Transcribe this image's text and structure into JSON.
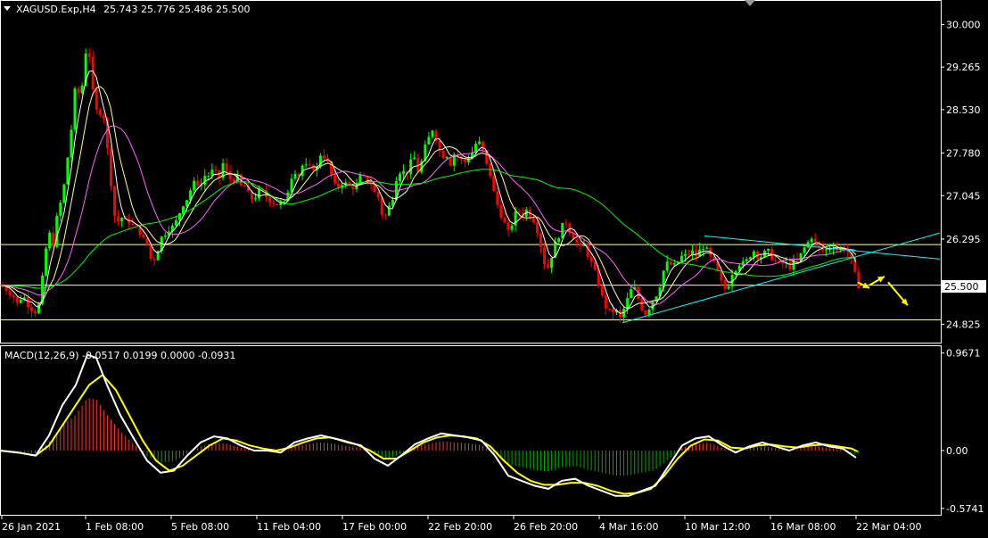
{
  "header": {
    "symbol": "XAGUSD.Exp,H4",
    "ohlc": "25.743 25.776 25.486 25.500",
    "menu_icon": "triangle-down-icon"
  },
  "macd_header": {
    "label": "MACD(12,26,9) -0.0517 0.0199 0.0000 -0.0931"
  },
  "colors": {
    "background": "#000000",
    "frame": "#ffffff",
    "bull_candle": "#00ff00",
    "bear_candle": "#ff0000",
    "ma_fast": "#ffff99",
    "ma_mid": "#ff66ff",
    "ma_slow": "#00ff00",
    "ma_white": "#ffffff",
    "trendline": "#00ffff",
    "hline": "#ffff99",
    "arrow": "#ffff00",
    "macd_line": "#ffffff",
    "signal_line": "#ffff00",
    "hist_pos": "#ff3333",
    "hist_neg": "#00aa00"
  },
  "chart_data": [
    {
      "type": "candlestick",
      "title": "XAGUSD.Exp,H4",
      "y_ticks": [
        "30.000",
        "29.265",
        "28.530",
        "27.780",
        "27.045",
        "26.295",
        "25.500",
        "24.825"
      ],
      "ylim": [
        24.6,
        30.3
      ],
      "x_ticks": [
        "26 Jan 2021",
        "1 Feb 08:00",
        "5 Feb 08:00",
        "11 Feb 04:00",
        "17 Feb 00:00",
        "22 Feb 20:00",
        "26 Feb 20:00",
        "4 Mar 16:00",
        "10 Mar 12:00",
        "16 Mar 08:00",
        "22 Mar 04:00"
      ],
      "current_price": "25.500",
      "horizontal_levels": [
        26.2,
        25.5,
        24.9
      ],
      "close_path": [
        [
          0,
          25.5
        ],
        [
          5,
          25.45
        ],
        [
          10,
          25.4
        ],
        [
          15,
          25.3
        ],
        [
          20,
          25.15
        ],
        [
          25,
          25.35
        ],
        [
          30,
          25.2
        ],
        [
          35,
          25.1
        ],
        [
          40,
          25.05
        ],
        [
          45,
          25.2
        ],
        [
          50,
          26.0
        ],
        [
          55,
          26.4
        ],
        [
          60,
          26.2
        ],
        [
          65,
          26.8
        ],
        [
          70,
          27.0
        ],
        [
          75,
          27.6
        ],
        [
          80,
          28.2
        ],
        [
          85,
          29.0
        ],
        [
          90,
          28.7
        ],
        [
          95,
          29.3
        ],
        [
          98,
          29.9
        ],
        [
          100,
          29.5
        ],
        [
          105,
          28.7
        ],
        [
          110,
          28.4
        ],
        [
          115,
          28.6
        ],
        [
          120,
          27.9
        ],
        [
          125,
          27.2
        ],
        [
          130,
          26.5
        ],
        [
          135,
          26.7
        ],
        [
          140,
          26.6
        ],
        [
          145,
          26.6
        ],
        [
          150,
          26.5
        ],
        [
          155,
          26.5
        ],
        [
          160,
          26.3
        ],
        [
          165,
          26.2
        ],
        [
          170,
          25.9
        ],
        [
          175,
          26.0
        ],
        [
          180,
          26.3
        ],
        [
          185,
          26.4
        ],
        [
          190,
          26.5
        ],
        [
          195,
          26.5
        ],
        [
          200,
          26.7
        ],
        [
          205,
          26.9
        ],
        [
          210,
          27.0
        ],
        [
          215,
          27.2
        ],
        [
          220,
          27.3
        ],
        [
          225,
          27.2
        ],
        [
          230,
          27.4
        ],
        [
          235,
          27.4
        ],
        [
          240,
          27.5
        ],
        [
          245,
          27.3
        ],
        [
          250,
          27.6
        ],
        [
          255,
          27.4
        ],
        [
          260,
          27.3
        ],
        [
          265,
          27.4
        ],
        [
          270,
          27.2
        ],
        [
          275,
          27.2
        ],
        [
          280,
          27.0
        ],
        [
          285,
          27.0
        ],
        [
          290,
          27.1
        ],
        [
          295,
          27.1
        ],
        [
          300,
          27.0
        ],
        [
          305,
          26.95
        ],
        [
          310,
          26.9
        ],
        [
          315,
          26.9
        ],
        [
          320,
          26.9
        ],
        [
          325,
          27.3
        ],
        [
          330,
          27.5
        ],
        [
          335,
          27.4
        ],
        [
          340,
          27.6
        ],
        [
          345,
          27.5
        ],
        [
          350,
          27.55
        ],
        [
          355,
          27.5
        ],
        [
          360,
          27.8
        ],
        [
          365,
          27.7
        ],
        [
          370,
          27.5
        ],
        [
          375,
          27.2
        ],
        [
          380,
          27.2
        ],
        [
          385,
          27.3
        ],
        [
          390,
          27.2
        ],
        [
          395,
          27.2
        ],
        [
          400,
          27.2
        ],
        [
          405,
          27.4
        ],
        [
          410,
          27.3
        ],
        [
          415,
          27.3
        ],
        [
          420,
          27.1
        ],
        [
          425,
          27.0
        ],
        [
          430,
          26.6
        ],
        [
          435,
          26.8
        ],
        [
          440,
          27.0
        ],
        [
          445,
          27.4
        ],
        [
          450,
          27.5
        ],
        [
          455,
          27.4
        ],
        [
          460,
          27.6
        ],
        [
          465,
          27.7
        ],
        [
          470,
          27.4
        ],
        [
          475,
          27.8
        ],
        [
          480,
          28.0
        ],
        [
          485,
          28.2
        ],
        [
          490,
          28.0
        ],
        [
          495,
          27.7
        ],
        [
          500,
          27.8
        ],
        [
          505,
          27.6
        ],
        [
          510,
          27.8
        ],
        [
          515,
          27.7
        ],
        [
          520,
          27.6
        ],
        [
          525,
          27.7
        ],
        [
          530,
          27.8
        ],
        [
          535,
          28.0
        ],
        [
          540,
          27.9
        ],
        [
          545,
          27.6
        ],
        [
          550,
          27.4
        ],
        [
          555,
          27.0
        ],
        [
          560,
          26.8
        ],
        [
          565,
          26.6
        ],
        [
          570,
          26.4
        ],
        [
          575,
          26.6
        ],
        [
          580,
          26.8
        ],
        [
          585,
          26.7
        ],
        [
          590,
          26.8
        ],
        [
          595,
          26.7
        ],
        [
          600,
          26.6
        ],
        [
          605,
          26.3
        ],
        [
          610,
          25.9
        ],
        [
          615,
          25.8
        ],
        [
          620,
          26.1
        ],
        [
          625,
          26.3
        ],
        [
          630,
          26.5
        ],
        [
          635,
          26.6
        ],
        [
          640,
          26.4
        ],
        [
          645,
          26.3
        ],
        [
          650,
          26.1
        ],
        [
          655,
          26.2
        ],
        [
          660,
          26.0
        ],
        [
          665,
          25.8
        ],
        [
          670,
          25.6
        ],
        [
          675,
          25.3
        ],
        [
          680,
          25.1
        ],
        [
          685,
          25.0
        ],
        [
          690,
          25.1
        ],
        [
          695,
          24.9
        ],
        [
          700,
          25.1
        ],
        [
          705,
          25.3
        ],
        [
          710,
          25.5
        ],
        [
          715,
          25.3
        ],
        [
          720,
          25.1
        ],
        [
          725,
          25.0
        ],
        [
          730,
          25.2
        ],
        [
          735,
          25.3
        ],
        [
          740,
          25.5
        ],
        [
          745,
          25.8
        ],
        [
          750,
          25.9
        ],
        [
          755,
          25.8
        ],
        [
          760,
          25.9
        ],
        [
          765,
          26.0
        ],
        [
          770,
          26.0
        ],
        [
          775,
          26.1
        ],
        [
          780,
          26.0
        ],
        [
          785,
          26.1
        ],
        [
          790,
          26.2
        ],
        [
          795,
          26.0
        ],
        [
          800,
          25.9
        ],
        [
          805,
          25.7
        ],
        [
          810,
          25.5
        ],
        [
          815,
          25.4
        ],
        [
          820,
          25.7
        ],
        [
          825,
          25.8
        ],
        [
          830,
          25.9
        ],
        [
          835,
          25.85
        ],
        [
          840,
          26.0
        ],
        [
          845,
          26.1
        ],
        [
          850,
          26.0
        ],
        [
          855,
          26.0
        ],
        [
          860,
          26.1
        ],
        [
          865,
          26.0
        ],
        [
          870,
          25.9
        ],
        [
          875,
          25.85
        ],
        [
          880,
          25.9
        ],
        [
          885,
          25.8
        ],
        [
          890,
          25.9
        ],
        [
          895,
          25.9
        ],
        [
          900,
          26.1
        ],
        [
          905,
          26.2
        ],
        [
          910,
          26.35
        ],
        [
          915,
          26.2
        ],
        [
          920,
          26.1
        ],
        [
          925,
          26.1
        ],
        [
          930,
          26.15
        ],
        [
          935,
          26.2
        ],
        [
          940,
          26.1
        ],
        [
          945,
          26.15
        ],
        [
          950,
          26.1
        ],
        [
          955,
          25.9
        ],
        [
          960,
          25.6
        ],
        [
          963,
          25.5
        ]
      ],
      "triangle_upper": [
        [
          790,
          26.35
        ],
        [
          1054,
          25.95
        ]
      ],
      "triangle_lower": [
        [
          698,
          24.85
        ],
        [
          1054,
          26.4
        ]
      ],
      "arrows": [
        {
          "from": [
            962,
            25.55
          ],
          "to": [
            975,
            25.45
          ]
        },
        {
          "from": [
            975,
            25.5
          ],
          "to": [
            992,
            25.65
          ]
        },
        {
          "from": [
            996,
            25.55
          ],
          "to": [
            1018,
            25.15
          ]
        }
      ]
    },
    {
      "type": "macd",
      "title": "MACD(12,26,9)",
      "y_ticks": [
        "0.9671",
        "0.00",
        "-0.5741"
      ],
      "ylim": [
        -0.62,
        1.0
      ],
      "macd_path": [
        [
          0,
          0.0
        ],
        [
          20,
          -0.02
        ],
        [
          40,
          -0.05
        ],
        [
          55,
          0.15
        ],
        [
          70,
          0.45
        ],
        [
          85,
          0.65
        ],
        [
          98,
          0.95
        ],
        [
          108,
          0.92
        ],
        [
          120,
          0.65
        ],
        [
          135,
          0.35
        ],
        [
          150,
          0.12
        ],
        [
          165,
          -0.1
        ],
        [
          180,
          -0.22
        ],
        [
          195,
          -0.2
        ],
        [
          210,
          -0.05
        ],
        [
          225,
          0.08
        ],
        [
          240,
          0.14
        ],
        [
          255,
          0.12
        ],
        [
          270,
          0.05
        ],
        [
          285,
          0.0
        ],
        [
          300,
          0.0
        ],
        [
          315,
          -0.02
        ],
        [
          330,
          0.08
        ],
        [
          345,
          0.12
        ],
        [
          360,
          0.15
        ],
        [
          375,
          0.12
        ],
        [
          390,
          0.08
        ],
        [
          405,
          0.05
        ],
        [
          420,
          -0.08
        ],
        [
          435,
          -0.15
        ],
        [
          450,
          -0.05
        ],
        [
          465,
          0.06
        ],
        [
          480,
          0.12
        ],
        [
          495,
          0.17
        ],
        [
          510,
          0.15
        ],
        [
          525,
          0.13
        ],
        [
          540,
          0.1
        ],
        [
          555,
          -0.05
        ],
        [
          570,
          -0.25
        ],
        [
          585,
          -0.3
        ],
        [
          600,
          -0.35
        ],
        [
          615,
          -0.38
        ],
        [
          630,
          -0.3
        ],
        [
          645,
          -0.28
        ],
        [
          660,
          -0.35
        ],
        [
          675,
          -0.4
        ],
        [
          690,
          -0.45
        ],
        [
          705,
          -0.45
        ],
        [
          720,
          -0.4
        ],
        [
          735,
          -0.35
        ],
        [
          750,
          -0.15
        ],
        [
          765,
          0.05
        ],
        [
          780,
          0.12
        ],
        [
          795,
          0.14
        ],
        [
          810,
          0.05
        ],
        [
          825,
          -0.02
        ],
        [
          840,
          0.04
        ],
        [
          855,
          0.08
        ],
        [
          870,
          0.04
        ],
        [
          885,
          0.0
        ],
        [
          900,
          0.05
        ],
        [
          915,
          0.08
        ],
        [
          930,
          0.04
        ],
        [
          945,
          0.02
        ],
        [
          960,
          -0.07
        ]
      ],
      "signal_path": [
        [
          0,
          0.0
        ],
        [
          20,
          -0.02
        ],
        [
          40,
          -0.05
        ],
        [
          55,
          0.05
        ],
        [
          70,
          0.25
        ],
        [
          85,
          0.45
        ],
        [
          100,
          0.65
        ],
        [
          115,
          0.75
        ],
        [
          130,
          0.6
        ],
        [
          145,
          0.35
        ],
        [
          160,
          0.1
        ],
        [
          175,
          -0.1
        ],
        [
          190,
          -0.2
        ],
        [
          205,
          -0.15
        ],
        [
          220,
          -0.05
        ],
        [
          235,
          0.05
        ],
        [
          250,
          0.12
        ],
        [
          265,
          0.1
        ],
        [
          280,
          0.05
        ],
        [
          295,
          0.02
        ],
        [
          310,
          0.0
        ],
        [
          325,
          0.03
        ],
        [
          340,
          0.08
        ],
        [
          355,
          0.12
        ],
        [
          370,
          0.13
        ],
        [
          385,
          0.1
        ],
        [
          400,
          0.06
        ],
        [
          415,
          0.0
        ],
        [
          430,
          -0.08
        ],
        [
          445,
          -0.08
        ],
        [
          460,
          0.0
        ],
        [
          475,
          0.08
        ],
        [
          490,
          0.13
        ],
        [
          505,
          0.15
        ],
        [
          520,
          0.14
        ],
        [
          535,
          0.12
        ],
        [
          550,
          0.04
        ],
        [
          565,
          -0.1
        ],
        [
          580,
          -0.22
        ],
        [
          595,
          -0.3
        ],
        [
          610,
          -0.34
        ],
        [
          625,
          -0.34
        ],
        [
          640,
          -0.32
        ],
        [
          655,
          -0.32
        ],
        [
          670,
          -0.35
        ],
        [
          685,
          -0.4
        ],
        [
          700,
          -0.43
        ],
        [
          715,
          -0.42
        ],
        [
          730,
          -0.38
        ],
        [
          745,
          -0.25
        ],
        [
          760,
          -0.08
        ],
        [
          775,
          0.05
        ],
        [
          790,
          0.11
        ],
        [
          805,
          0.1
        ],
        [
          820,
          0.03
        ],
        [
          835,
          0.02
        ],
        [
          850,
          0.05
        ],
        [
          865,
          0.06
        ],
        [
          880,
          0.04
        ],
        [
          895,
          0.03
        ],
        [
          910,
          0.05
        ],
        [
          925,
          0.06
        ],
        [
          940,
          0.04
        ],
        [
          955,
          0.02
        ],
        [
          962,
          -0.01
        ]
      ]
    }
  ]
}
